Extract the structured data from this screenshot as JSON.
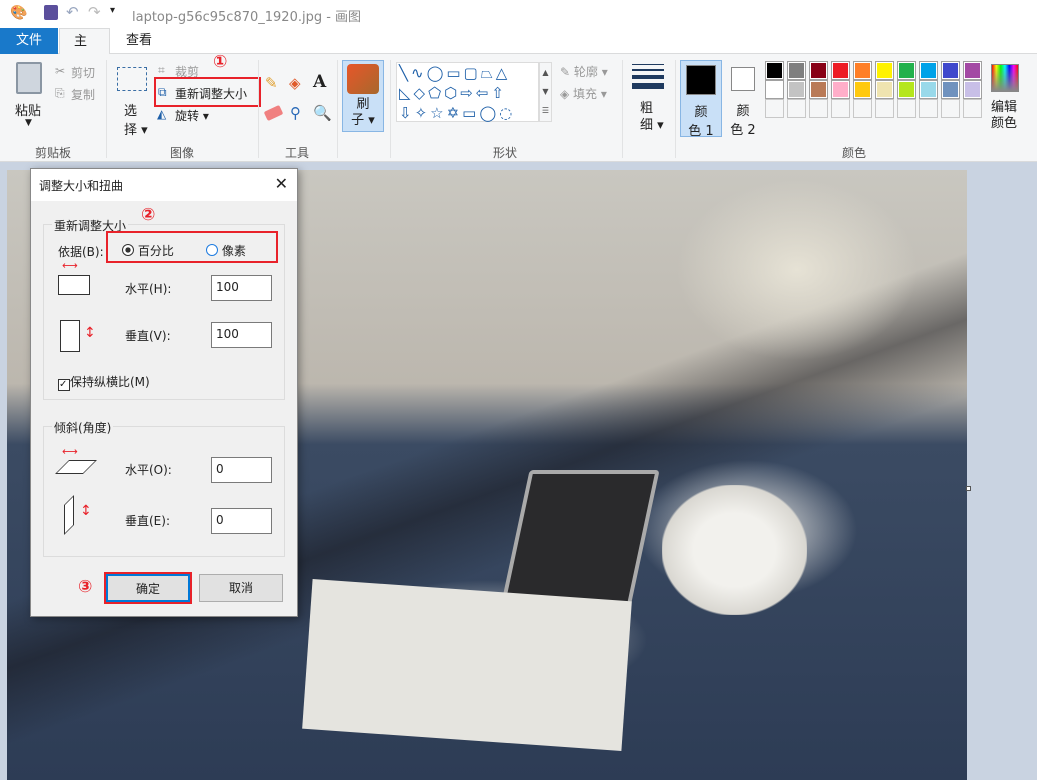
{
  "window": {
    "title": "laptop-g56c95c870_1920.jpg - 画图"
  },
  "tabs": [
    {
      "label": "文件"
    },
    {
      "label": "主页"
    },
    {
      "label": "查看"
    }
  ],
  "clipboard": {
    "paste": "粘贴",
    "cut": "剪切",
    "copy": "复制",
    "group": "剪贴板"
  },
  "image": {
    "select_1": "选",
    "select_2": "择",
    "crop": "裁剪",
    "resize": "重新调整大小",
    "rotate": "旋转",
    "group": "图像"
  },
  "tools": {
    "group": "工具"
  },
  "brush": {
    "l1": "刷",
    "l2": "子"
  },
  "shapes": {
    "outline": "轮廓",
    "fill": "填充",
    "group": "形状"
  },
  "size": {
    "l1": "粗",
    "l2": "细"
  },
  "colors": {
    "c1a": "颜",
    "c1b": "色 1",
    "c2a": "颜",
    "c2b": "色 2",
    "edit_a": "编辑",
    "edit_b": "颜色",
    "group": "颜色",
    "palette": [
      "#000000",
      "#7f7f7f",
      "#880015",
      "#ed1c24",
      "#ff7f27",
      "#fff200",
      "#22b14c",
      "#00a2e8",
      "#3f48cc",
      "#a349a4",
      "#ffffff",
      "#c3c3c3",
      "#b97a57",
      "#ffaec9",
      "#ffc90e",
      "#efe4b0",
      "#b5e61d",
      "#99d9ea",
      "#7092be",
      "#c8bfe7"
    ]
  },
  "annotations": {
    "n1": "①",
    "n2": "②",
    "n3": "③"
  },
  "dialog": {
    "title": "调整大小和扭曲",
    "resize_group": "重新调整大小",
    "by": "依据(B):",
    "percent": "百分比",
    "pixels": "像素",
    "h_label": "水平(H):",
    "h_value": "100",
    "v_label": "垂直(V):",
    "v_value": "100",
    "keep_ratio": "保持纵横比(M)",
    "skew_group": "倾斜(角度)",
    "skew_h_label": "水平(O):",
    "skew_h_value": "0",
    "skew_v_label": "垂直(E):",
    "skew_v_value": "0",
    "ok": "确定",
    "cancel": "取消"
  }
}
